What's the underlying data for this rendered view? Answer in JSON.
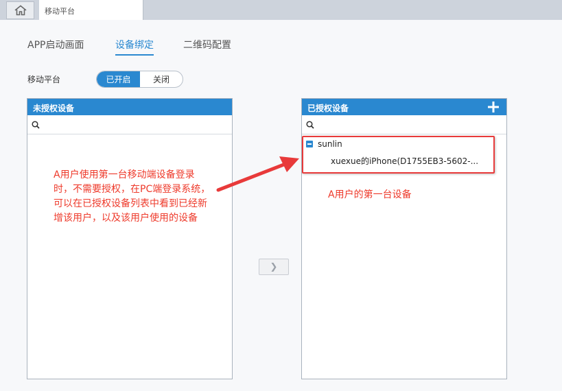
{
  "tab_bar": {
    "home_icon": "home-icon",
    "page_tab": "移动平台"
  },
  "nav": {
    "tabs": [
      {
        "label": "APP启动画面",
        "active": false
      },
      {
        "label": "设备绑定",
        "active": true
      },
      {
        "label": "二维码配置",
        "active": false
      }
    ]
  },
  "platform": {
    "label": "移动平台",
    "on_label": "已开启",
    "off_label": "关闭"
  },
  "unauthorized_panel": {
    "title": "未授权设备",
    "search_placeholder": ""
  },
  "authorized_panel": {
    "title": "已授权设备",
    "add_icon": "plus-icon",
    "search_placeholder": "",
    "tree": {
      "user": "sunlin",
      "device": "xuexue的iPhone(D1755EB3-5602-..."
    }
  },
  "transfer_button": "❯",
  "annotations": {
    "left_note": "A用户使用第一台移动端设备登录时，不需要授权，在PC端登录系统，可以在已授权设备列表中看到已经新增该用户，以及该用户使用的设备",
    "right_note": "A用户的第一台设备"
  },
  "colors": {
    "accent": "#2a88d0",
    "annotation": "#e83a3a"
  }
}
